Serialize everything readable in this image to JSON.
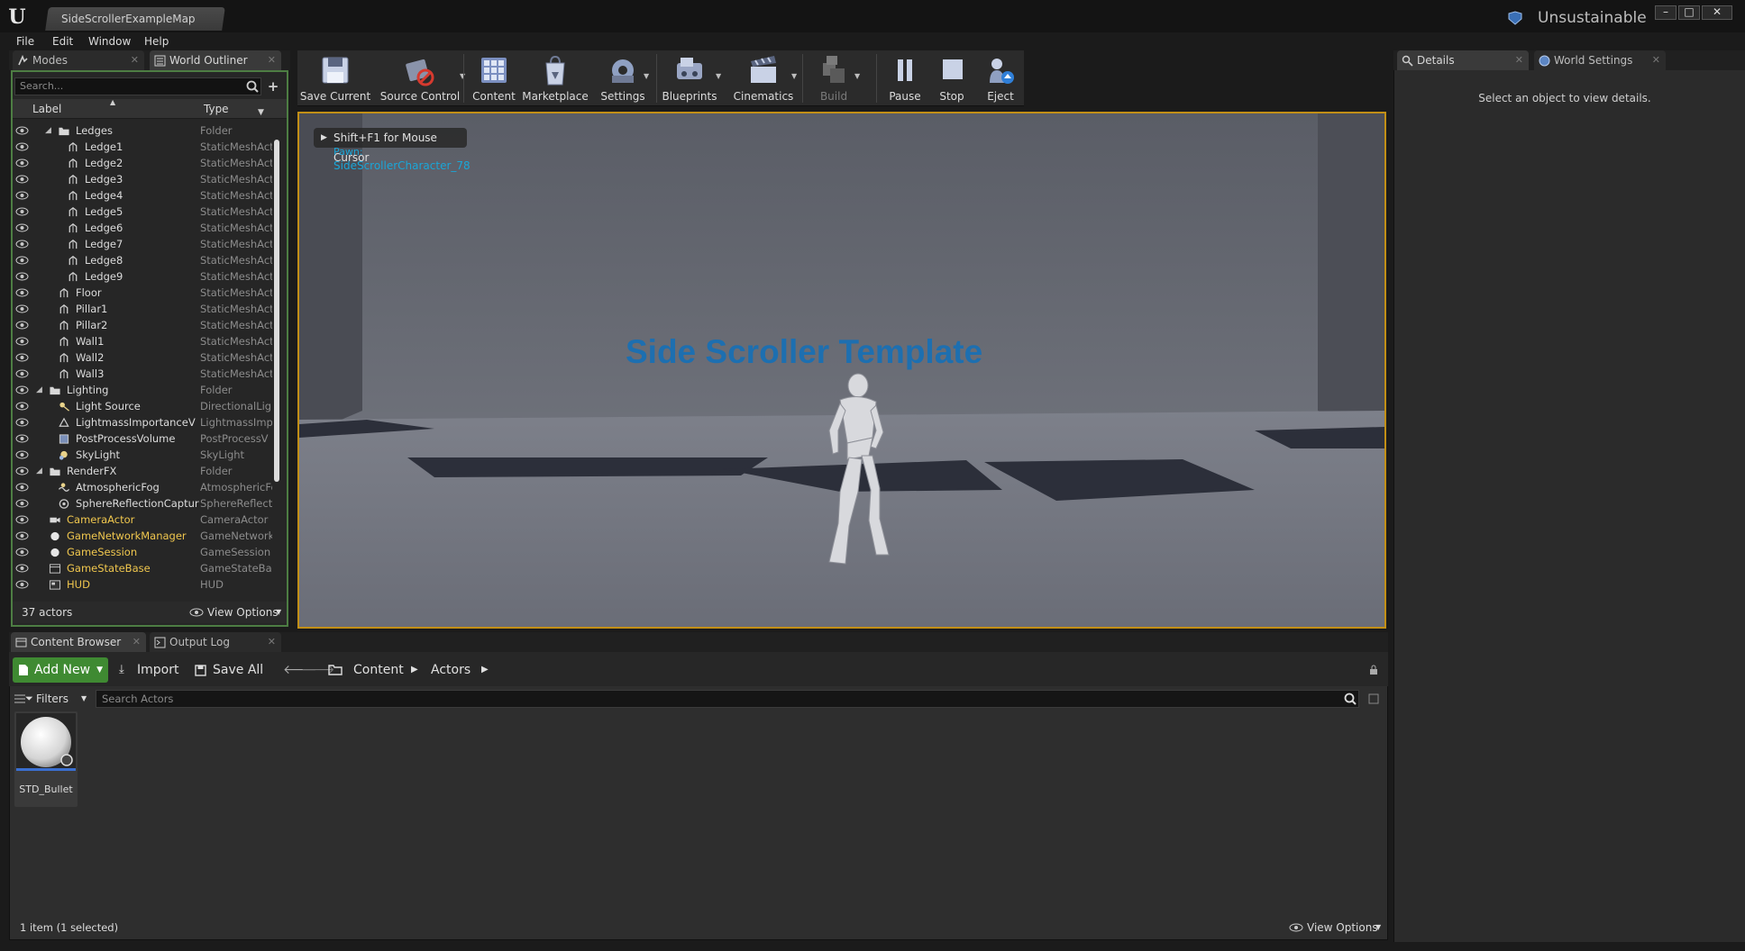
{
  "window": {
    "document_tab": "SideScrollerExampleMap",
    "project_name": "Unsustainable",
    "controls": [
      "–",
      "□",
      "✕"
    ]
  },
  "menu": [
    "File",
    "Edit",
    "Window",
    "Help"
  ],
  "left_tabs": [
    {
      "label": "Modes",
      "icon": "modes-icon",
      "active": false
    },
    {
      "label": "World Outliner",
      "icon": "world-outliner-icon",
      "active": true
    }
  ],
  "outliner": {
    "search_placeholder": "Search...",
    "col_label": "Label",
    "col_type": "Type",
    "rows": [
      {
        "label": "Ledges",
        "type": "Folder",
        "indent": 2,
        "icon": "folder-icon",
        "expanded": true,
        "color": "white"
      },
      {
        "label": "Ledge1",
        "type": "StaticMeshAct",
        "indent": 3,
        "icon": "static-mesh-icon",
        "color": "white"
      },
      {
        "label": "Ledge2",
        "type": "StaticMeshAct",
        "indent": 3,
        "icon": "static-mesh-icon",
        "color": "white"
      },
      {
        "label": "Ledge3",
        "type": "StaticMeshAct",
        "indent": 3,
        "icon": "static-mesh-icon",
        "color": "white"
      },
      {
        "label": "Ledge4",
        "type": "StaticMeshAct",
        "indent": 3,
        "icon": "static-mesh-icon",
        "color": "white"
      },
      {
        "label": "Ledge5",
        "type": "StaticMeshAct",
        "indent": 3,
        "icon": "static-mesh-icon",
        "color": "white"
      },
      {
        "label": "Ledge6",
        "type": "StaticMeshAct",
        "indent": 3,
        "icon": "static-mesh-icon",
        "color": "white"
      },
      {
        "label": "Ledge7",
        "type": "StaticMeshAct",
        "indent": 3,
        "icon": "static-mesh-icon",
        "color": "white"
      },
      {
        "label": "Ledge8",
        "type": "StaticMeshAct",
        "indent": 3,
        "icon": "static-mesh-icon",
        "color": "white"
      },
      {
        "label": "Ledge9",
        "type": "StaticMeshAct",
        "indent": 3,
        "icon": "static-mesh-icon",
        "color": "white"
      },
      {
        "label": "Floor",
        "type": "StaticMeshAct",
        "indent": 2,
        "icon": "static-mesh-icon",
        "color": "white"
      },
      {
        "label": "Pillar1",
        "type": "StaticMeshAct",
        "indent": 2,
        "icon": "static-mesh-icon",
        "color": "white"
      },
      {
        "label": "Pillar2",
        "type": "StaticMeshAct",
        "indent": 2,
        "icon": "static-mesh-icon",
        "color": "white"
      },
      {
        "label": "Wall1",
        "type": "StaticMeshAct",
        "indent": 2,
        "icon": "static-mesh-icon",
        "color": "white"
      },
      {
        "label": "Wall2",
        "type": "StaticMeshAct",
        "indent": 2,
        "icon": "static-mesh-icon",
        "color": "white"
      },
      {
        "label": "Wall3",
        "type": "StaticMeshAct",
        "indent": 2,
        "icon": "static-mesh-icon",
        "color": "white"
      },
      {
        "label": "Lighting",
        "type": "Folder",
        "indent": 1,
        "icon": "folder-icon",
        "expanded": true,
        "color": "white"
      },
      {
        "label": "Light Source",
        "type": "DirectionalLig",
        "indent": 2,
        "icon": "directional-light-icon",
        "color": "white"
      },
      {
        "label": "LightmassImportanceV",
        "type": "LightmassImp",
        "indent": 2,
        "icon": "lightmass-icon",
        "color": "white"
      },
      {
        "label": "PostProcessVolume",
        "type": "PostProcessV",
        "indent": 2,
        "icon": "post-process-icon",
        "color": "white"
      },
      {
        "label": "SkyLight",
        "type": "SkyLight",
        "indent": 2,
        "icon": "skylight-icon",
        "color": "white"
      },
      {
        "label": "RenderFX",
        "type": "Folder",
        "indent": 1,
        "icon": "folder-icon",
        "expanded": true,
        "color": "white"
      },
      {
        "label": "AtmosphericFog",
        "type": "AtmosphericFo",
        "indent": 2,
        "icon": "fog-icon",
        "color": "white"
      },
      {
        "label": "SphereReflectionCaptur",
        "type": "SphereReflecti",
        "indent": 2,
        "icon": "reflection-capture-icon",
        "color": "white"
      },
      {
        "label": "CameraActor",
        "type": "CameraActor",
        "indent": 1,
        "icon": "camera-icon",
        "color": "yellow"
      },
      {
        "label": "GameNetworkManager",
        "type": "GameNetworkI",
        "indent": 1,
        "icon": "sphere-icon",
        "color": "yellow"
      },
      {
        "label": "GameSession",
        "type": "GameSession",
        "indent": 1,
        "icon": "sphere-icon",
        "color": "yellow"
      },
      {
        "label": "GameStateBase",
        "type": "GameStateBas",
        "indent": 1,
        "icon": "gamestate-icon",
        "color": "yellow"
      },
      {
        "label": "HUD",
        "type": "HUD",
        "indent": 1,
        "icon": "hud-icon",
        "color": "yellow"
      }
    ],
    "actor_count": "37 actors",
    "view_options": "View Options"
  },
  "toolbar": [
    {
      "label": "Save Current",
      "icon": "save-icon",
      "dropdown": false,
      "enabled": true
    },
    {
      "label": "Source Control",
      "icon": "source-control-icon",
      "dropdown": true,
      "enabled": true
    },
    {
      "label": "Content",
      "icon": "content-icon",
      "dropdown": false,
      "enabled": true
    },
    {
      "label": "Marketplace",
      "icon": "marketplace-icon",
      "dropdown": false,
      "enabled": true
    },
    {
      "label": "Settings",
      "icon": "settings-icon",
      "dropdown": true,
      "enabled": true
    },
    {
      "label": "Blueprints",
      "icon": "blueprints-icon",
      "dropdown": true,
      "enabled": true
    },
    {
      "label": "Cinematics",
      "icon": "cinematics-icon",
      "dropdown": true,
      "enabled": true
    },
    {
      "label": "Build",
      "icon": "build-icon",
      "dropdown": true,
      "enabled": false
    },
    {
      "label": "Pause",
      "icon": "pause-icon",
      "dropdown": false,
      "enabled": true
    },
    {
      "label": "Stop",
      "icon": "stop-icon",
      "dropdown": false,
      "enabled": true
    },
    {
      "label": "Eject",
      "icon": "eject-icon",
      "dropdown": false,
      "enabled": true
    }
  ],
  "viewport": {
    "hint": "Shift+F1 for Mouse Cursor",
    "pawn_label": "Pawn:",
    "character_label": "SideScrollerCharacter_78",
    "scene_title": "Side Scroller Template"
  },
  "right_tabs": [
    {
      "label": "Details",
      "icon": "details-icon",
      "active": true
    },
    {
      "label": "World Settings",
      "icon": "world-settings-icon",
      "active": false
    }
  ],
  "details": {
    "empty_message": "Select an object to view details."
  },
  "bottom_tabs": [
    {
      "label": "Content Browser",
      "icon": "content-browser-icon",
      "active": true
    },
    {
      "label": "Output Log",
      "icon": "output-log-icon",
      "active": false
    }
  ],
  "content_browser": {
    "add_new": "Add New",
    "import": "Import",
    "save_all": "Save All",
    "path": [
      "Content",
      "Actors"
    ],
    "filters": "Filters",
    "search_placeholder": "Search Actors",
    "assets": [
      {
        "name": "STD_Bullet"
      }
    ],
    "status": "1 item (1 selected)",
    "view_options": "View Options"
  },
  "colors": {
    "accent_green": "#3f8a32",
    "viewport_border": "#c28f16",
    "actor_yellow": "#f0c74e",
    "debug_cyan": "#1aa6d8",
    "title_blue": "#1d6fb0"
  }
}
